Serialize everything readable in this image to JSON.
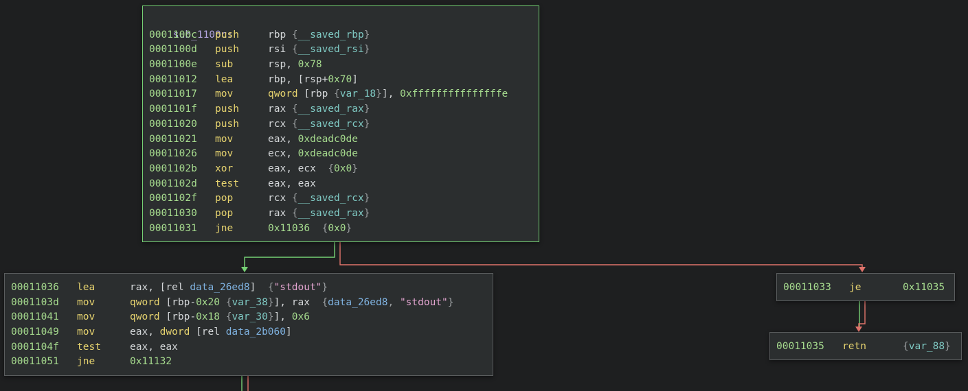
{
  "colors": {
    "background": "#1e1f20",
    "block_fill": "#2b2e2f",
    "block_border": "#5a5d5e",
    "entry_border": "#76d275",
    "edge_true": "#76d275",
    "edge_false": "#e0736b",
    "address": "#a6db8e",
    "mnemonic": "#e6d36f",
    "register": "#d3d6d8",
    "number": "#a6db8e",
    "variable": "#7fc9c3",
    "symbol": "#7fb2e0",
    "string": "#e2a4cf"
  },
  "blocks": [
    {
      "id": "sub_1100c",
      "label": "sub_1100c:",
      "lines": [
        {
          "addr": "0001100c",
          "mn": "push",
          "ops": [
            [
              "reg",
              "rbp "
            ],
            [
              "br",
              "{"
            ],
            [
              "var",
              "__saved_rbp"
            ],
            [
              "br",
              "}"
            ]
          ]
        },
        {
          "addr": "0001100d",
          "mn": "push",
          "ops": [
            [
              "reg",
              "rsi "
            ],
            [
              "br",
              "{"
            ],
            [
              "var",
              "__saved_rsi"
            ],
            [
              "br",
              "}"
            ]
          ]
        },
        {
          "addr": "0001100e",
          "mn": "sub",
          "ops": [
            [
              "reg",
              "rsp, "
            ],
            [
              "num",
              "0x78"
            ]
          ]
        },
        {
          "addr": "00011012",
          "mn": "lea",
          "ops": [
            [
              "reg",
              "rbp, "
            ],
            [
              "pun",
              "["
            ],
            [
              "reg",
              "rsp"
            ],
            [
              "pun",
              "+"
            ],
            [
              "num",
              "0x70"
            ],
            [
              "pun",
              "]"
            ]
          ]
        },
        {
          "addr": "00011017",
          "mn": "mov",
          "ops": [
            [
              "kw",
              "qword "
            ],
            [
              "pun",
              "["
            ],
            [
              "reg",
              "rbp "
            ],
            [
              "br",
              "{"
            ],
            [
              "var",
              "var_18"
            ],
            [
              "br",
              "}"
            ],
            [
              "pun",
              "], "
            ],
            [
              "num",
              "0xfffffffffffffffe"
            ]
          ]
        },
        {
          "addr": "0001101f",
          "mn": "push",
          "ops": [
            [
              "reg",
              "rax "
            ],
            [
              "br",
              "{"
            ],
            [
              "var",
              "__saved_rax"
            ],
            [
              "br",
              "}"
            ]
          ]
        },
        {
          "addr": "00011020",
          "mn": "push",
          "ops": [
            [
              "reg",
              "rcx "
            ],
            [
              "br",
              "{"
            ],
            [
              "var",
              "__saved_rcx"
            ],
            [
              "br",
              "}"
            ]
          ]
        },
        {
          "addr": "00011021",
          "mn": "mov",
          "ops": [
            [
              "reg",
              "eax, "
            ],
            [
              "num",
              "0xdeadc0de"
            ]
          ]
        },
        {
          "addr": "00011026",
          "mn": "mov",
          "ops": [
            [
              "reg",
              "ecx, "
            ],
            [
              "num",
              "0xdeadc0de"
            ]
          ]
        },
        {
          "addr": "0001102b",
          "mn": "xor",
          "ops": [
            [
              "reg",
              "eax, ecx  "
            ],
            [
              "br",
              "{"
            ],
            [
              "num",
              "0x0"
            ],
            [
              "br",
              "}"
            ]
          ]
        },
        {
          "addr": "0001102d",
          "mn": "test",
          "ops": [
            [
              "reg",
              "eax, eax"
            ]
          ]
        },
        {
          "addr": "0001102f",
          "mn": "pop",
          "ops": [
            [
              "reg",
              "rcx "
            ],
            [
              "br",
              "{"
            ],
            [
              "var",
              "__saved_rcx"
            ],
            [
              "br",
              "}"
            ]
          ]
        },
        {
          "addr": "00011030",
          "mn": "pop",
          "ops": [
            [
              "reg",
              "rax "
            ],
            [
              "br",
              "{"
            ],
            [
              "var",
              "__saved_rax"
            ],
            [
              "br",
              "}"
            ]
          ]
        },
        {
          "addr": "00011031",
          "mn": "jne",
          "ops": [
            [
              "num",
              "0x11036  "
            ],
            [
              "br",
              "{"
            ],
            [
              "num",
              "0x0"
            ],
            [
              "br",
              "}"
            ]
          ]
        }
      ]
    },
    {
      "id": "blk_11036",
      "label": "",
      "lines": [
        {
          "addr": "00011036",
          "mn": "lea",
          "ops": [
            [
              "reg",
              "rax, "
            ],
            [
              "pun",
              "["
            ],
            [
              "reg",
              "rel "
            ],
            [
              "sym",
              "data_26ed8"
            ],
            [
              "pun",
              "]  "
            ],
            [
              "br",
              "{"
            ],
            [
              "str",
              "\"stdout\""
            ],
            [
              "br",
              "}"
            ]
          ]
        },
        {
          "addr": "0001103d",
          "mn": "mov",
          "ops": [
            [
              "kw",
              "qword "
            ],
            [
              "pun",
              "["
            ],
            [
              "reg",
              "rbp"
            ],
            [
              "pun",
              "-"
            ],
            [
              "num",
              "0x20 "
            ],
            [
              "br",
              "{"
            ],
            [
              "var",
              "var_38"
            ],
            [
              "br",
              "}"
            ],
            [
              "pun",
              "], "
            ],
            [
              "reg",
              "rax  "
            ],
            [
              "br",
              "{"
            ],
            [
              "sym",
              "data_26ed8"
            ],
            [
              "br",
              ", "
            ],
            [
              "str",
              "\"stdout\""
            ],
            [
              "br",
              "}"
            ]
          ]
        },
        {
          "addr": "00011041",
          "mn": "mov",
          "ops": [
            [
              "kw",
              "qword "
            ],
            [
              "pun",
              "["
            ],
            [
              "reg",
              "rbp"
            ],
            [
              "pun",
              "-"
            ],
            [
              "num",
              "0x18 "
            ],
            [
              "br",
              "{"
            ],
            [
              "var",
              "var_30"
            ],
            [
              "br",
              "}"
            ],
            [
              "pun",
              "], "
            ],
            [
              "num",
              "0x6"
            ]
          ]
        },
        {
          "addr": "00011049",
          "mn": "mov",
          "ops": [
            [
              "reg",
              "eax, "
            ],
            [
              "kw",
              "dword "
            ],
            [
              "pun",
              "["
            ],
            [
              "reg",
              "rel "
            ],
            [
              "sym",
              "data_2b060"
            ],
            [
              "pun",
              "]"
            ]
          ]
        },
        {
          "addr": "0001104f",
          "mn": "test",
          "ops": [
            [
              "reg",
              "eax, eax"
            ]
          ]
        },
        {
          "addr": "00011051",
          "mn": "jne",
          "ops": [
            [
              "num",
              "0x11132"
            ]
          ]
        }
      ]
    },
    {
      "id": "blk_11033",
      "label": "",
      "lines": [
        {
          "addr": "00011033",
          "mn": "je",
          "ops": [
            [
              "num",
              "0x11035"
            ]
          ]
        }
      ]
    },
    {
      "id": "blk_11035",
      "label": "",
      "lines": [
        {
          "addr": "00011035",
          "mn": "retn",
          "ops": [
            [
              "br",
              "{"
            ],
            [
              "var",
              "var_88"
            ],
            [
              "br",
              "}"
            ]
          ]
        }
      ]
    }
  ]
}
